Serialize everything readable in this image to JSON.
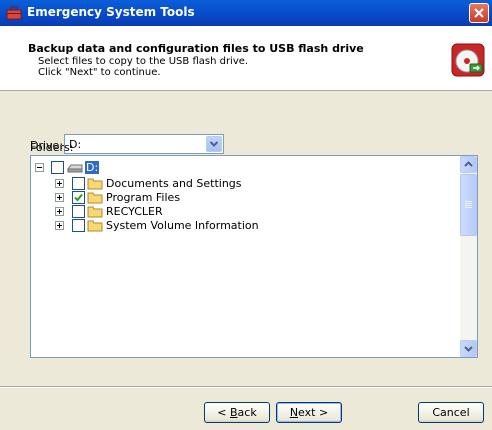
{
  "window": {
    "title": "Emergency System Tools"
  },
  "header": {
    "title": "Backup data and configuration files to USB flash drive",
    "line1": "Select files to copy to the USB flash drive.",
    "line2": "Click \"Next\" to continue."
  },
  "drive": {
    "label": "Drive:",
    "value": "D:"
  },
  "folders": {
    "label": "Folders:",
    "root": {
      "label": "D:",
      "checked": false,
      "expanded": true
    },
    "items": [
      {
        "label": "Documents and Settings",
        "checked": false
      },
      {
        "label": "Program Files",
        "checked": true
      },
      {
        "label": "RECYCLER",
        "checked": false
      },
      {
        "label": "System Volume Information",
        "checked": false
      }
    ]
  },
  "buttons": {
    "back_mnemonic": "B",
    "back_rest": "ack",
    "next_mnemonic": "N",
    "next_rest": "ext >",
    "back_prefix": "< ",
    "cancel": "Cancel"
  },
  "colors": {
    "titlebar": "#0748c9",
    "selection": "#316ac5",
    "checkmark": "#21a121"
  }
}
